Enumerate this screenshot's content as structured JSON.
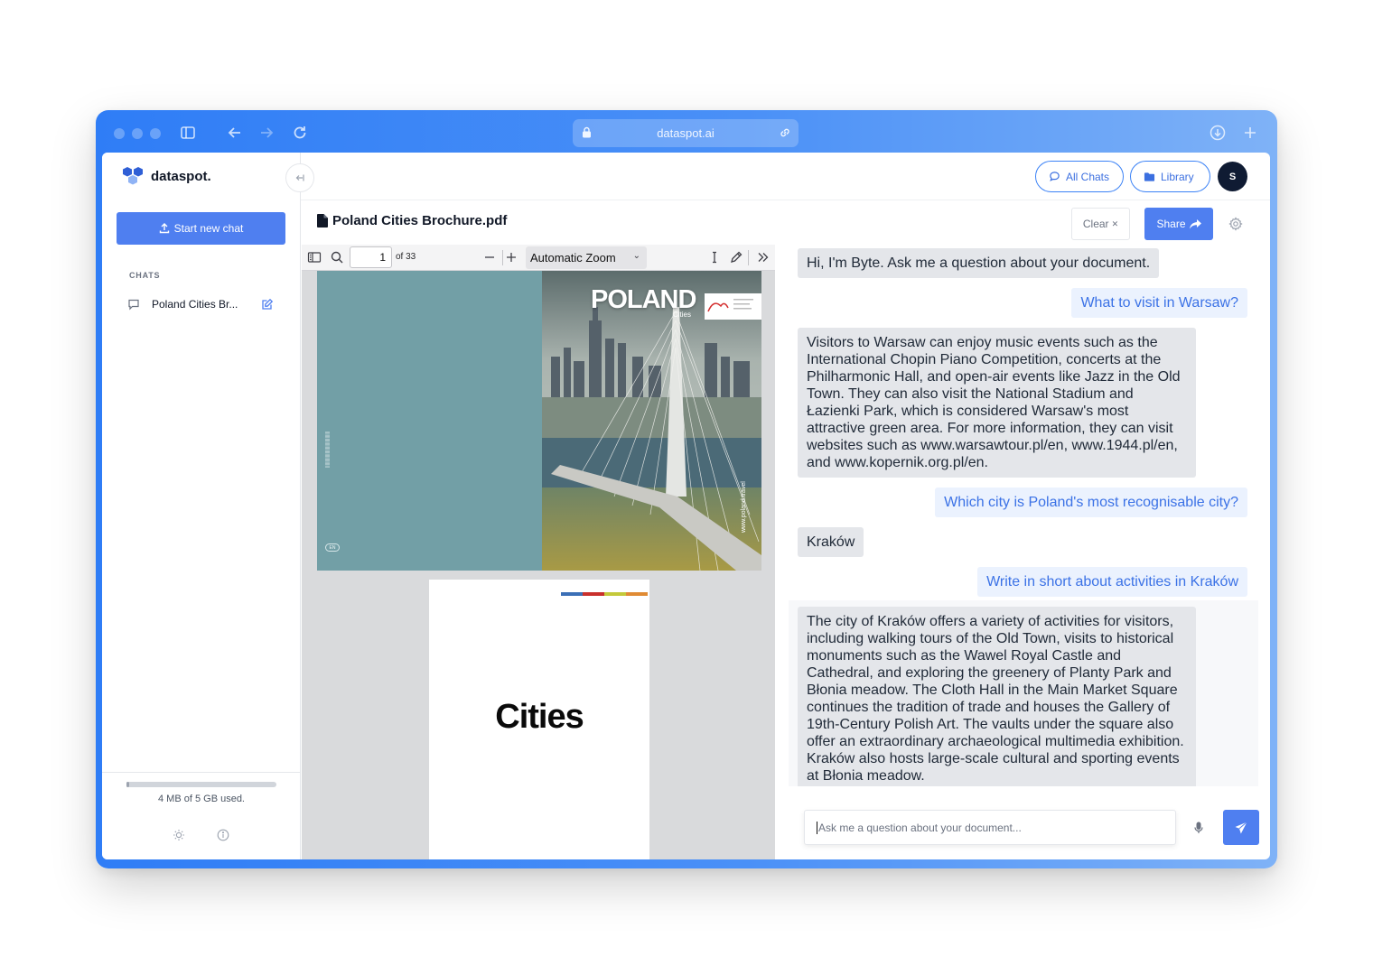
{
  "browser": {
    "url": "dataspot.ai"
  },
  "sidebar": {
    "brand": "dataspot.",
    "new_chat_label": "Start new chat",
    "chats_heading": "CHATS",
    "chats": [
      {
        "label": "Poland Cities Br..."
      }
    ],
    "storage": {
      "used_text": "4 MB of 5 GB used.",
      "used_fraction": 0.001
    }
  },
  "header": {
    "all_chats_label": "All Chats",
    "library_label": "Library",
    "avatar_initial": "S"
  },
  "document": {
    "filename": "Poland Cities Brochure.pdf",
    "clear_label": "Clear",
    "share_label": "Share"
  },
  "pdf_viewer": {
    "page_number": "1",
    "page_count_label": "of 33",
    "zoom_label": "Automatic Zoom",
    "cover_title": "POLAND",
    "cover_subtitle": "Cities",
    "cover_url": "www.poland.travel",
    "cover_lang": "EN",
    "page2_title": "Cities"
  },
  "chat": {
    "messages": [
      {
        "role": "bot",
        "text": "Hi, I'm Byte. Ask me a question about your document."
      },
      {
        "role": "user",
        "text": "What to visit in Warsaw?"
      },
      {
        "role": "bot",
        "text": "Visitors to Warsaw can enjoy music events such as the International Chopin Piano Competition, concerts at the Philharmonic Hall, and open-air events like Jazz in the Old Town. They can also visit the National Stadium and Łazienki Park, which is considered Warsaw's most attractive green area. For more information, they can visit websites such as www.warsawtour.pl/en, www.1944.pl/en, and www.kopernik.org.pl/en."
      },
      {
        "role": "user",
        "text": "Which city is Poland's most recognisable city?"
      },
      {
        "role": "bot",
        "text": "Kraków"
      },
      {
        "role": "user",
        "text": "Write in short about activities in Kraków"
      },
      {
        "role": "bot",
        "text": "The city of Kraków offers a variety of activities for visitors, including walking tours of the Old Town, visits to historical monuments such as the Wawel Royal Castle and Cathedral, and exploring the greenery of Planty Park and Błonia meadow. The Cloth Hall in the Main Market Square continues the tradition of trade and houses the Gallery of 19th-Century Polish Art. The vaults under the square also offer an extraordinary archaeological multimedia exhibition. Kraków also hosts large-scale cultural and sporting events at Błonia meadow."
      }
    ],
    "input_placeholder": "Ask me a question about your document..."
  },
  "colors": {
    "brand_blue": "#4f7ff0",
    "frame_gradient_start": "#2f7df6",
    "frame_gradient_end": "#7fb2f7",
    "user_bubble_bg": "#ebf2fe",
    "bot_bubble_bg": "#e4e6ea"
  }
}
